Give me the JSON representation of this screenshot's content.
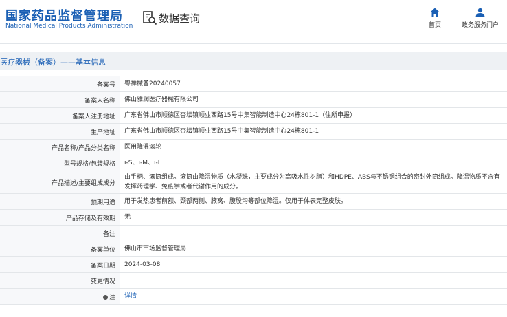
{
  "header": {
    "brand_cn": "国家药品监督管理局",
    "brand_en": "National Medical Products Administration",
    "query_label": "数据查询",
    "nav": [
      {
        "label": "首页",
        "icon": "home-icon"
      },
      {
        "label": "政务服务门户",
        "icon": "user-icon"
      }
    ]
  },
  "section": {
    "title": "医疗器械（备案）——基本信息"
  },
  "rows": [
    {
      "key": "备案号",
      "value": "粤禅械备20240057"
    },
    {
      "key": "备案人名称",
      "value": "佛山雅润医疗器械有限公司"
    },
    {
      "key": "备案人注册地址",
      "value": "广东省佛山市顺德区杏坛镇顺业西路15号中集智能制造中心24栋801-1（住所申报）"
    },
    {
      "key": "生产地址",
      "value": "广东省佛山市顺德区杏坛镇顺业西路15号中集智能制造中心24栋801-1"
    },
    {
      "key": "产品名称/产品分类名称",
      "value": "医用降温滚轮"
    },
    {
      "key": "型号规格/包装规格",
      "value": "i-S、i-M、i-L"
    },
    {
      "key": "产品描述/主要组成成分",
      "value": "由手柄、滚筒组成。滚筒由降温物质（水凝珠，主要成分为高吸水性树脂）和HDPE、ABS与不锈钢组合的密封外筒组成。降温物质不含有发挥药理学、免疫学或者代谢作用的成分。"
    },
    {
      "key": "预期用途",
      "value": "用于发热患者前额、颈部两侧、腋窝、腹股沟等部位降温。仅用于体表完整皮肤。"
    },
    {
      "key": "产品存储及有效期",
      "value": "无"
    },
    {
      "key": "备注",
      "value": ""
    },
    {
      "key": "备案单位",
      "value": "佛山市市场监督管理局"
    },
    {
      "key": "备案日期",
      "value": "2024-03-08"
    },
    {
      "key": "变更情况",
      "value": ""
    },
    {
      "key": "注",
      "value": "详情"
    }
  ],
  "colors": {
    "brand": "#1a5fb4",
    "section_bg": "#eef1f4",
    "key_bg": "#f7f8fa"
  }
}
